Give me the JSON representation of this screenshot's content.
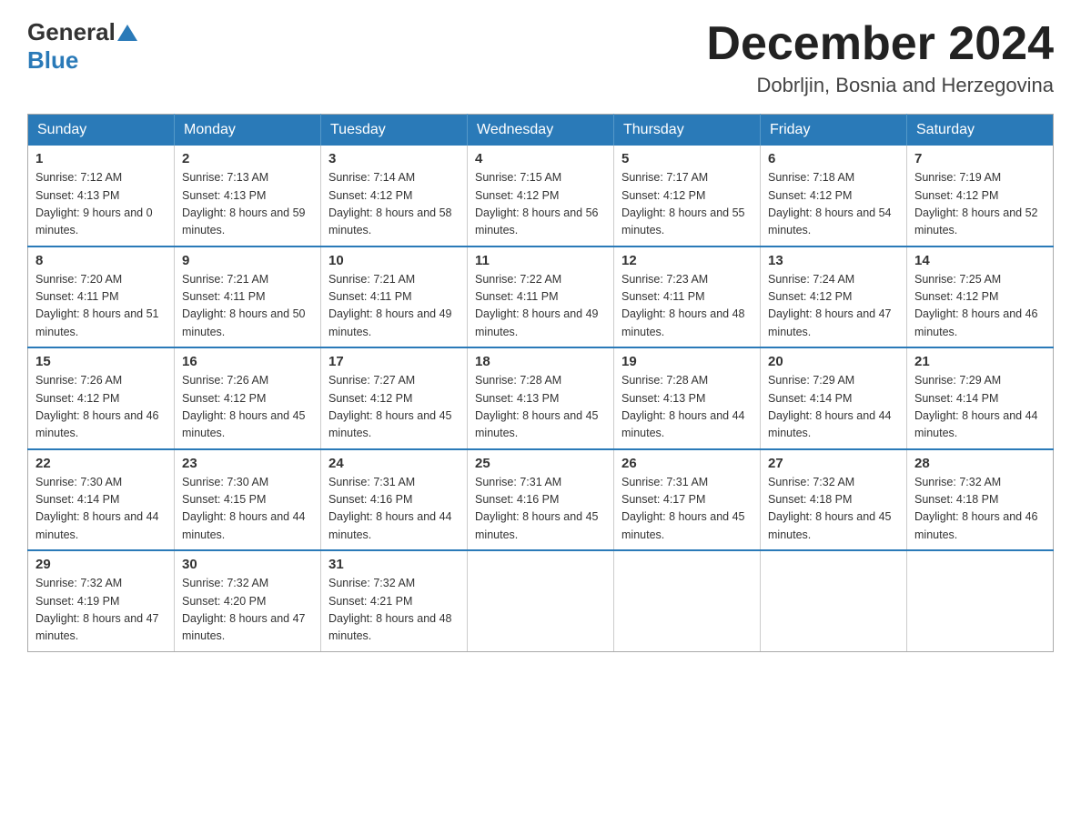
{
  "header": {
    "logo_text1": "General",
    "logo_text2": "Blue",
    "month_title": "December 2024",
    "location": "Dobrljin, Bosnia and Herzegovina"
  },
  "weekdays": [
    "Sunday",
    "Monday",
    "Tuesday",
    "Wednesday",
    "Thursday",
    "Friday",
    "Saturday"
  ],
  "weeks": [
    [
      {
        "day": "1",
        "sunrise": "7:12 AM",
        "sunset": "4:13 PM",
        "daylight": "9 hours and 0 minutes."
      },
      {
        "day": "2",
        "sunrise": "7:13 AM",
        "sunset": "4:13 PM",
        "daylight": "8 hours and 59 minutes."
      },
      {
        "day": "3",
        "sunrise": "7:14 AM",
        "sunset": "4:12 PM",
        "daylight": "8 hours and 58 minutes."
      },
      {
        "day": "4",
        "sunrise": "7:15 AM",
        "sunset": "4:12 PM",
        "daylight": "8 hours and 56 minutes."
      },
      {
        "day": "5",
        "sunrise": "7:17 AM",
        "sunset": "4:12 PM",
        "daylight": "8 hours and 55 minutes."
      },
      {
        "day": "6",
        "sunrise": "7:18 AM",
        "sunset": "4:12 PM",
        "daylight": "8 hours and 54 minutes."
      },
      {
        "day": "7",
        "sunrise": "7:19 AM",
        "sunset": "4:12 PM",
        "daylight": "8 hours and 52 minutes."
      }
    ],
    [
      {
        "day": "8",
        "sunrise": "7:20 AM",
        "sunset": "4:11 PM",
        "daylight": "8 hours and 51 minutes."
      },
      {
        "day": "9",
        "sunrise": "7:21 AM",
        "sunset": "4:11 PM",
        "daylight": "8 hours and 50 minutes."
      },
      {
        "day": "10",
        "sunrise": "7:21 AM",
        "sunset": "4:11 PM",
        "daylight": "8 hours and 49 minutes."
      },
      {
        "day": "11",
        "sunrise": "7:22 AM",
        "sunset": "4:11 PM",
        "daylight": "8 hours and 49 minutes."
      },
      {
        "day": "12",
        "sunrise": "7:23 AM",
        "sunset": "4:11 PM",
        "daylight": "8 hours and 48 minutes."
      },
      {
        "day": "13",
        "sunrise": "7:24 AM",
        "sunset": "4:12 PM",
        "daylight": "8 hours and 47 minutes."
      },
      {
        "day": "14",
        "sunrise": "7:25 AM",
        "sunset": "4:12 PM",
        "daylight": "8 hours and 46 minutes."
      }
    ],
    [
      {
        "day": "15",
        "sunrise": "7:26 AM",
        "sunset": "4:12 PM",
        "daylight": "8 hours and 46 minutes."
      },
      {
        "day": "16",
        "sunrise": "7:26 AM",
        "sunset": "4:12 PM",
        "daylight": "8 hours and 45 minutes."
      },
      {
        "day": "17",
        "sunrise": "7:27 AM",
        "sunset": "4:12 PM",
        "daylight": "8 hours and 45 minutes."
      },
      {
        "day": "18",
        "sunrise": "7:28 AM",
        "sunset": "4:13 PM",
        "daylight": "8 hours and 45 minutes."
      },
      {
        "day": "19",
        "sunrise": "7:28 AM",
        "sunset": "4:13 PM",
        "daylight": "8 hours and 44 minutes."
      },
      {
        "day": "20",
        "sunrise": "7:29 AM",
        "sunset": "4:14 PM",
        "daylight": "8 hours and 44 minutes."
      },
      {
        "day": "21",
        "sunrise": "7:29 AM",
        "sunset": "4:14 PM",
        "daylight": "8 hours and 44 minutes."
      }
    ],
    [
      {
        "day": "22",
        "sunrise": "7:30 AM",
        "sunset": "4:14 PM",
        "daylight": "8 hours and 44 minutes."
      },
      {
        "day": "23",
        "sunrise": "7:30 AM",
        "sunset": "4:15 PM",
        "daylight": "8 hours and 44 minutes."
      },
      {
        "day": "24",
        "sunrise": "7:31 AM",
        "sunset": "4:16 PM",
        "daylight": "8 hours and 44 minutes."
      },
      {
        "day": "25",
        "sunrise": "7:31 AM",
        "sunset": "4:16 PM",
        "daylight": "8 hours and 45 minutes."
      },
      {
        "day": "26",
        "sunrise": "7:31 AM",
        "sunset": "4:17 PM",
        "daylight": "8 hours and 45 minutes."
      },
      {
        "day": "27",
        "sunrise": "7:32 AM",
        "sunset": "4:18 PM",
        "daylight": "8 hours and 45 minutes."
      },
      {
        "day": "28",
        "sunrise": "7:32 AM",
        "sunset": "4:18 PM",
        "daylight": "8 hours and 46 minutes."
      }
    ],
    [
      {
        "day": "29",
        "sunrise": "7:32 AM",
        "sunset": "4:19 PM",
        "daylight": "8 hours and 47 minutes."
      },
      {
        "day": "30",
        "sunrise": "7:32 AM",
        "sunset": "4:20 PM",
        "daylight": "8 hours and 47 minutes."
      },
      {
        "day": "31",
        "sunrise": "7:32 AM",
        "sunset": "4:21 PM",
        "daylight": "8 hours and 48 minutes."
      },
      null,
      null,
      null,
      null
    ]
  ]
}
